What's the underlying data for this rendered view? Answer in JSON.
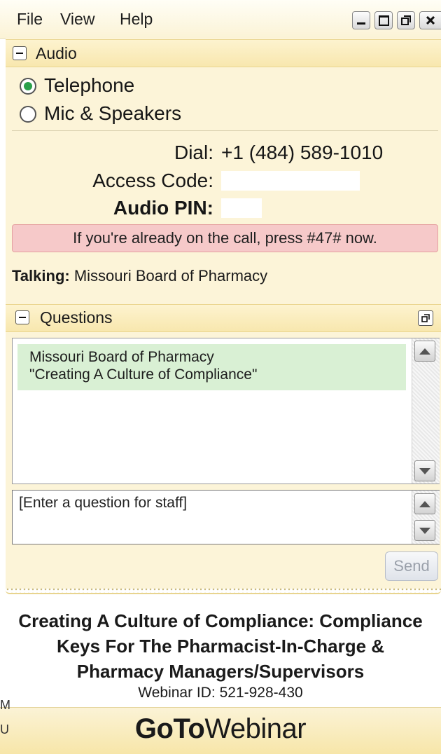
{
  "menu": {
    "file": "File",
    "view": "View",
    "help": "Help"
  },
  "window_controls": [
    "minimize-icon",
    "maximize-icon",
    "restore-icon",
    "close-icon"
  ],
  "audio": {
    "title": "Audio",
    "options": [
      {
        "label": "Telephone",
        "selected": true
      },
      {
        "label": "Mic & Speakers",
        "selected": false
      }
    ],
    "dial_label": "Dial:",
    "dial_value": "+1 (484) 589-1010",
    "access_code_label": "Access Code:",
    "audio_pin_label": "Audio PIN:",
    "alert": "If you're already on the call, press #47# now.",
    "talking_label": "Talking:",
    "talking_value": "Missouri Board of Pharmacy"
  },
  "questions": {
    "title": "Questions",
    "message_line1": "Missouri Board of Pharmacy",
    "message_line2": "\"Creating A Culture of Compliance\"",
    "input_placeholder": "[Enter a question for staff]",
    "send_label": "Send"
  },
  "webinar": {
    "title_line1": "Creating A Culture of Compliance:  Compliance",
    "title_line2": "Keys For The Pharmacist-In-Charge &",
    "title_line3": "Pharmacy Managers/Supervisors",
    "id_text": "Webinar ID: 521-928-430"
  },
  "brand": {
    "part1": "GoTo",
    "part2": "Webinar"
  },
  "edge_fragments": [
    "M",
    "U"
  ],
  "colors": {
    "panel_bg": "#fcf4d8",
    "alert_bg": "#f6c9c9",
    "message_bg": "#d9f0d4",
    "radio_selected": "#2aa04a"
  }
}
